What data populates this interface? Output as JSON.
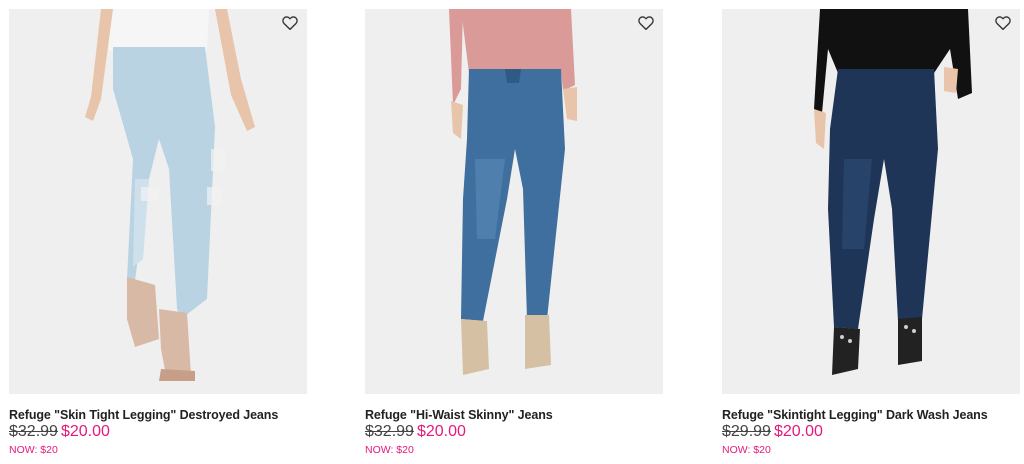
{
  "products": [
    {
      "name": "Refuge \"Skin Tight Legging\" Destroyed Jeans",
      "original_price": "$32.99",
      "sale_price": "$20.00",
      "now_price": "NOW: $20",
      "wash_color": "#b9d3e3",
      "top_color": "#f6f6f6",
      "shoe_color": "#d8b9a6"
    },
    {
      "name": "Refuge \"Hi-Waist Skinny\" Jeans",
      "original_price": "$32.99",
      "sale_price": "$20.00",
      "now_price": "NOW: $20",
      "wash_color": "#3e6f9e",
      "top_color": "#d99a98",
      "shoe_color": "#d6c0a4"
    },
    {
      "name": "Refuge \"Skintight Legging\" Dark Wash Jeans",
      "original_price": "$29.99",
      "sale_price": "$20.00",
      "now_price": "NOW: $20",
      "wash_color": "#1e3557",
      "top_color": "#111111",
      "shoe_color": "#222222"
    }
  ],
  "colors": {
    "sale": "#e5197c",
    "tile_bg": "#eeeeee",
    "skin": "#e8c4aa"
  },
  "icons": {
    "wishlist": "heart-outline-icon"
  }
}
